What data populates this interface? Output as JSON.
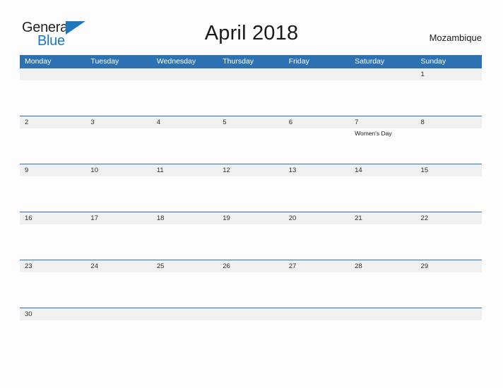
{
  "brand": {
    "logo_line1": "General",
    "logo_line2": "Blue",
    "logo_icon": "triangle-icon",
    "color_dark": "#231f20",
    "color_blue": "#1f76bc"
  },
  "header": {
    "title": "April 2018",
    "location": "Mozambique"
  },
  "theme": {
    "header_blue": "#2e71b3",
    "row_border_blue": "#2e71b3",
    "date_band_gray": "#f0f0f0",
    "page_background": "#fdfdfd",
    "text_dark": "#1a1a1a",
    "weekday_text": "#ffffff"
  },
  "calendar": {
    "month": "April",
    "year": "2018",
    "weekday_headers": [
      "Monday",
      "Tuesday",
      "Wednesday",
      "Thursday",
      "Friday",
      "Saturday",
      "Sunday"
    ],
    "weeks": [
      {
        "dates": [
          "",
          "",
          "",
          "",
          "",
          "",
          "1"
        ],
        "events": [
          "",
          "",
          "",
          "",
          "",
          "",
          ""
        ]
      },
      {
        "dates": [
          "2",
          "3",
          "4",
          "5",
          "6",
          "7",
          "8"
        ],
        "events": [
          "",
          "",
          "",
          "",
          "",
          "Women's Day",
          ""
        ]
      },
      {
        "dates": [
          "9",
          "10",
          "11",
          "12",
          "13",
          "14",
          "15"
        ],
        "events": [
          "",
          "",
          "",
          "",
          "",
          "",
          ""
        ]
      },
      {
        "dates": [
          "16",
          "17",
          "18",
          "19",
          "20",
          "21",
          "22"
        ],
        "events": [
          "",
          "",
          "",
          "",
          "",
          "",
          ""
        ]
      },
      {
        "dates": [
          "23",
          "24",
          "25",
          "26",
          "27",
          "28",
          "29"
        ],
        "events": [
          "",
          "",
          "",
          "",
          "",
          "",
          ""
        ]
      },
      {
        "dates": [
          "30",
          "",
          "",
          "",
          "",
          "",
          ""
        ],
        "events": [
          "",
          "",
          "",
          "",
          "",
          "",
          ""
        ]
      }
    ],
    "holidays": [
      {
        "date": "7",
        "weekday": "Saturday",
        "name": "Women's Day"
      }
    ]
  }
}
